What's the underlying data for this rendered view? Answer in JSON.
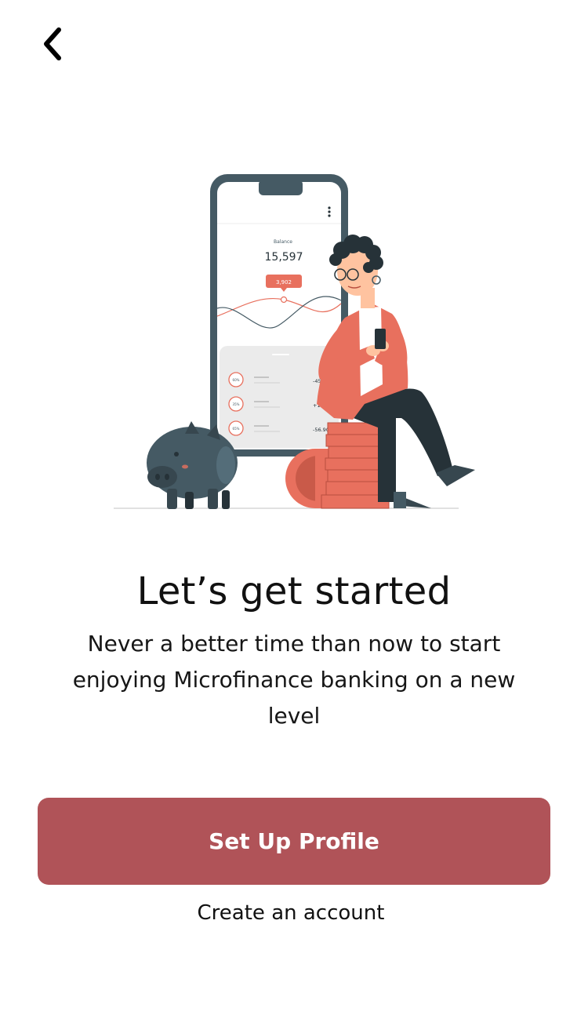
{
  "icons": {
    "back": "chevron-left-icon",
    "phone_menu": "more-vertical-icon"
  },
  "colors": {
    "primary_button": "#b05358",
    "illustration_accent": "#e8705e",
    "illustration_dark": "#455a64"
  },
  "illustration": {
    "balance_label": "Balance",
    "balance_value": "15,597",
    "highlight_value": "3,902",
    "rows": [
      {
        "percent": "60%",
        "amount": "-45.90"
      },
      {
        "percent": "35%",
        "amount": "+100"
      },
      {
        "percent": "65%",
        "amount": "-56.90"
      }
    ]
  },
  "onboarding": {
    "title": "Let’s get started",
    "subtitle": "Never a better time than now to start enjoying Microfinance banking on a new level",
    "primary_button": "Set Up Profile",
    "secondary_link": "Create an account"
  }
}
